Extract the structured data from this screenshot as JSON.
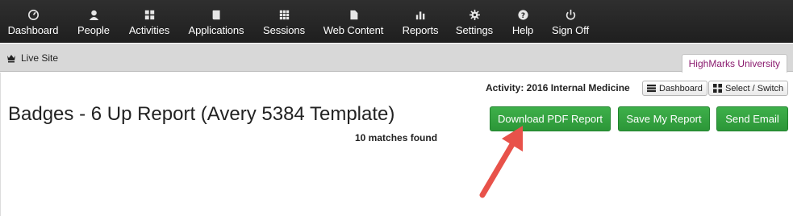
{
  "nav": {
    "items": [
      {
        "label": "Dashboard",
        "icon": "dashboard-icon"
      },
      {
        "label": "People",
        "icon": "person-icon"
      },
      {
        "label": "Activities",
        "icon": "grid-icon"
      },
      {
        "label": "Applications",
        "icon": "book-icon"
      },
      {
        "label": "Sessions",
        "icon": "dots-grid-icon"
      },
      {
        "label": "Web Content",
        "icon": "file-icon"
      },
      {
        "label": "Reports",
        "icon": "bar-chart-icon"
      },
      {
        "label": "Settings",
        "icon": "gear-icon"
      },
      {
        "label": "Help",
        "icon": "question-icon"
      },
      {
        "label": "Sign Off",
        "icon": "power-icon"
      }
    ]
  },
  "subbar": {
    "live_site": "Live Site",
    "org_tab": "HighMarks University"
  },
  "activity": {
    "label": "Activity: 2016 Internal Medicine",
    "dashboard_btn": "Dashboard",
    "switch_btn": "Select / Switch"
  },
  "report": {
    "title": "Badges - 6 Up Report (Avery 5384 Template)",
    "matches": "10 matches found",
    "download_btn": "Download PDF Report",
    "save_btn": "Save My Report",
    "email_btn": "Send Email"
  },
  "colors": {
    "nav_bg": "#262626",
    "button_green": "#35a342",
    "org_tab_text": "#8a1a6e",
    "annotation_arrow": "#e8524a"
  }
}
